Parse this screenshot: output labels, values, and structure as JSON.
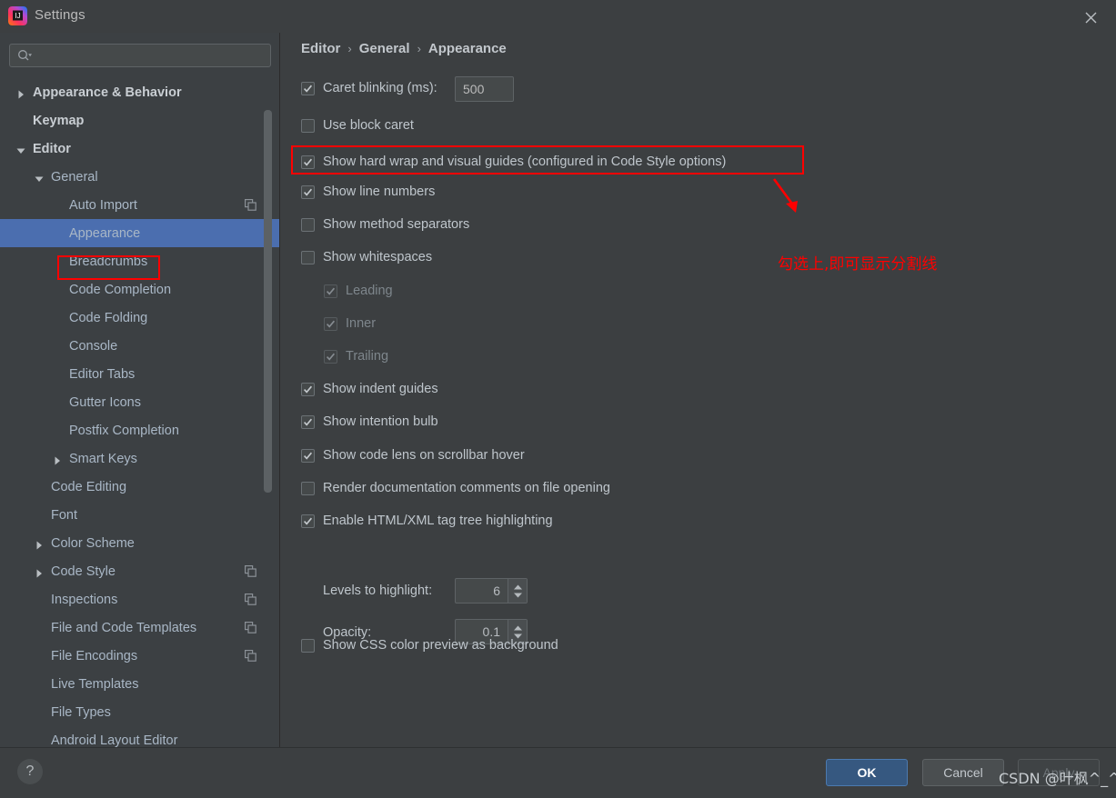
{
  "window": {
    "title": "Settings",
    "logo_icon": "intellij-idea-logo",
    "close_icon": "close-icon"
  },
  "sidebar": {
    "search": {
      "value": "",
      "placeholder": "",
      "icon": "search-icon",
      "dropdown_icon": "chevron-down-icon"
    },
    "items": [
      {
        "label": "Appearance & Behavior",
        "indent": 0,
        "arrow": "right",
        "bold": true,
        "copy": false,
        "selected": false
      },
      {
        "label": "Keymap",
        "indent": 0,
        "arrow": "none",
        "bold": true,
        "copy": false,
        "selected": false
      },
      {
        "label": "Editor",
        "indent": 0,
        "arrow": "down",
        "bold": true,
        "copy": false,
        "selected": false
      },
      {
        "label": "General",
        "indent": 1,
        "arrow": "down",
        "bold": false,
        "copy": false,
        "selected": false
      },
      {
        "label": "Auto Import",
        "indent": 2,
        "arrow": "none",
        "bold": false,
        "copy": true,
        "selected": false
      },
      {
        "label": "Appearance",
        "indent": 2,
        "arrow": "none",
        "bold": false,
        "copy": false,
        "selected": true
      },
      {
        "label": "Breadcrumbs",
        "indent": 2,
        "arrow": "none",
        "bold": false,
        "copy": false,
        "selected": false
      },
      {
        "label": "Code Completion",
        "indent": 2,
        "arrow": "none",
        "bold": false,
        "copy": false,
        "selected": false
      },
      {
        "label": "Code Folding",
        "indent": 2,
        "arrow": "none",
        "bold": false,
        "copy": false,
        "selected": false
      },
      {
        "label": "Console",
        "indent": 2,
        "arrow": "none",
        "bold": false,
        "copy": false,
        "selected": false
      },
      {
        "label": "Editor Tabs",
        "indent": 2,
        "arrow": "none",
        "bold": false,
        "copy": false,
        "selected": false
      },
      {
        "label": "Gutter Icons",
        "indent": 2,
        "arrow": "none",
        "bold": false,
        "copy": false,
        "selected": false
      },
      {
        "label": "Postfix Completion",
        "indent": 2,
        "arrow": "none",
        "bold": false,
        "copy": false,
        "selected": false
      },
      {
        "label": "Smart Keys",
        "indent": 2,
        "arrow": "right",
        "bold": false,
        "copy": false,
        "selected": false
      },
      {
        "label": "Code Editing",
        "indent": 1,
        "arrow": "none",
        "bold": false,
        "copy": false,
        "selected": false
      },
      {
        "label": "Font",
        "indent": 1,
        "arrow": "none",
        "bold": false,
        "copy": false,
        "selected": false
      },
      {
        "label": "Color Scheme",
        "indent": 1,
        "arrow": "right",
        "bold": false,
        "copy": false,
        "selected": false
      },
      {
        "label": "Code Style",
        "indent": 1,
        "arrow": "right",
        "bold": false,
        "copy": true,
        "selected": false
      },
      {
        "label": "Inspections",
        "indent": 1,
        "arrow": "none",
        "bold": false,
        "copy": true,
        "selected": false
      },
      {
        "label": "File and Code Templates",
        "indent": 1,
        "arrow": "none",
        "bold": false,
        "copy": true,
        "selected": false
      },
      {
        "label": "File Encodings",
        "indent": 1,
        "arrow": "none",
        "bold": false,
        "copy": true,
        "selected": false
      },
      {
        "label": "Live Templates",
        "indent": 1,
        "arrow": "none",
        "bold": false,
        "copy": false,
        "selected": false
      },
      {
        "label": "File Types",
        "indent": 1,
        "arrow": "none",
        "bold": false,
        "copy": false,
        "selected": false
      },
      {
        "label": "Android Layout Editor",
        "indent": 1,
        "arrow": "none",
        "bold": false,
        "copy": false,
        "selected": false
      }
    ]
  },
  "breadcrumb": {
    "part1": "Editor",
    "part2": "General",
    "part3": "Appearance",
    "separator": "›"
  },
  "options": {
    "caret_blinking": {
      "label": "Caret blinking (ms):",
      "checked": true,
      "value": "500"
    },
    "use_block_caret": {
      "label": "Use block caret",
      "checked": false
    },
    "show_hard_wrap": {
      "label": "Show hard wrap and visual guides (configured in Code Style options)",
      "checked": true
    },
    "show_line_numbers": {
      "label": "Show line numbers",
      "checked": true
    },
    "show_method_separators": {
      "label": "Show method separators",
      "checked": false
    },
    "show_whitespaces": {
      "label": "Show whitespaces",
      "checked": false
    },
    "leading": {
      "label": "Leading",
      "checked": true,
      "enabled": false
    },
    "inner": {
      "label": "Inner",
      "checked": true,
      "enabled": false
    },
    "trailing": {
      "label": "Trailing",
      "checked": true,
      "enabled": false
    },
    "show_indent_guides": {
      "label": "Show indent guides",
      "checked": true
    },
    "show_intention_bulb": {
      "label": "Show intention bulb",
      "checked": true
    },
    "show_code_lens": {
      "label": "Show code lens on scrollbar hover",
      "checked": true
    },
    "render_doc_comments": {
      "label": "Render documentation comments on file opening",
      "checked": false
    },
    "enable_html_xml": {
      "label": "Enable HTML/XML tag tree highlighting",
      "checked": true
    },
    "levels_to_highlight": {
      "label": "Levels to highlight:",
      "value": "6"
    },
    "opacity": {
      "label": "Opacity:",
      "value": "0.1"
    },
    "show_css_preview": {
      "label": "Show CSS color preview as background",
      "checked": false
    }
  },
  "annotation": {
    "text": "勾选上,即可显示分割线",
    "color": "#ff0000",
    "arrow_icon": "red-arrow-icon"
  },
  "footer": {
    "help_label": "?",
    "ok_label": "OK",
    "cancel_label": "Cancel",
    "apply_label": "Apply",
    "watermark": "CSDN @叶枫^_^"
  },
  "colors": {
    "accent_blue": "#4b6eaf",
    "ok_button": "#365880",
    "annotation_red": "#ff0000",
    "panel_bg": "#3c3f41",
    "sidebar_bg": "#3c4043",
    "text": "#bfc6cc"
  }
}
